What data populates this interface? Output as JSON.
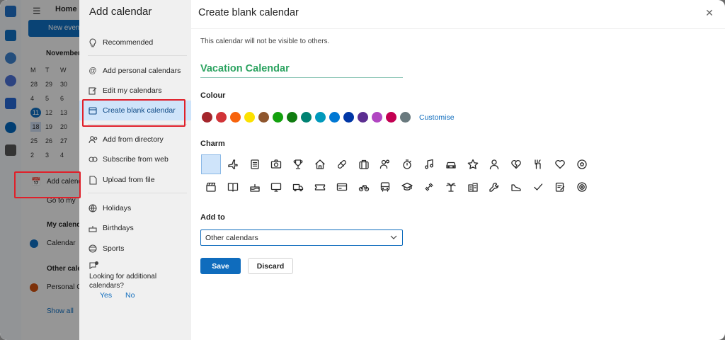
{
  "background": {
    "tab_home": "Home",
    "new_event": "New event",
    "month": "November",
    "weekday_headers": [
      "M",
      "T",
      "W"
    ],
    "calendar_days": [
      "28",
      "29",
      "30",
      "4",
      "5",
      "6",
      "11",
      "12",
      "13",
      "18",
      "19",
      "20",
      "25",
      "26",
      "27",
      "2",
      "3",
      "4"
    ],
    "add_calendar": "Add calendar",
    "go_to_my": "Go to my",
    "my_calendars": "My calendars",
    "calendar": "Calendar",
    "other_calendars": "Other calendars",
    "personal": "Personal G",
    "show_all": "Show all"
  },
  "panel": {
    "title": "Add calendar",
    "items": [
      {
        "label": "Recommended",
        "icon": "lightbulb-icon"
      },
      {
        "label": "Add personal calendars",
        "icon": "at-icon"
      },
      {
        "label": "Edit my calendars",
        "icon": "edit-icon"
      },
      {
        "label": "Create blank calendar",
        "icon": "calendar-icon"
      },
      {
        "label": "Add from directory",
        "icon": "people-icon"
      },
      {
        "label": "Subscribe from web",
        "icon": "link-icon"
      },
      {
        "label": "Upload from file",
        "icon": "file-icon"
      },
      {
        "label": "Holidays",
        "icon": "globe-icon"
      },
      {
        "label": "Birthdays",
        "icon": "cake-icon"
      },
      {
        "label": "Sports",
        "icon": "ball-icon"
      }
    ],
    "looking_text": "Looking for additional calendars?",
    "yes": "Yes",
    "no": "No"
  },
  "dialog": {
    "title": "Create blank calendar",
    "visibility_note": "This calendar will not be visible to others.",
    "calendar_name": "Vacation Calendar",
    "colour_label": "Colour",
    "colours": [
      "#a4262c",
      "#d13438",
      "#f7630c",
      "#fce100",
      "#8e562e",
      "#13a10e",
      "#107c10",
      "#008272",
      "#0099bc",
      "#0078d4",
      "#0037a6",
      "#5c2e91",
      "#b146c2",
      "#c30052",
      "#69797e"
    ],
    "customise": "Customise",
    "charm_label": "Charm",
    "add_to_label": "Add to",
    "add_to_value": "Other calendars",
    "save": "Save",
    "discard": "Discard"
  },
  "colors": {
    "accent": "#0f6cbd",
    "name_green": "#2ba360",
    "highlight_red": "#e0202a"
  }
}
